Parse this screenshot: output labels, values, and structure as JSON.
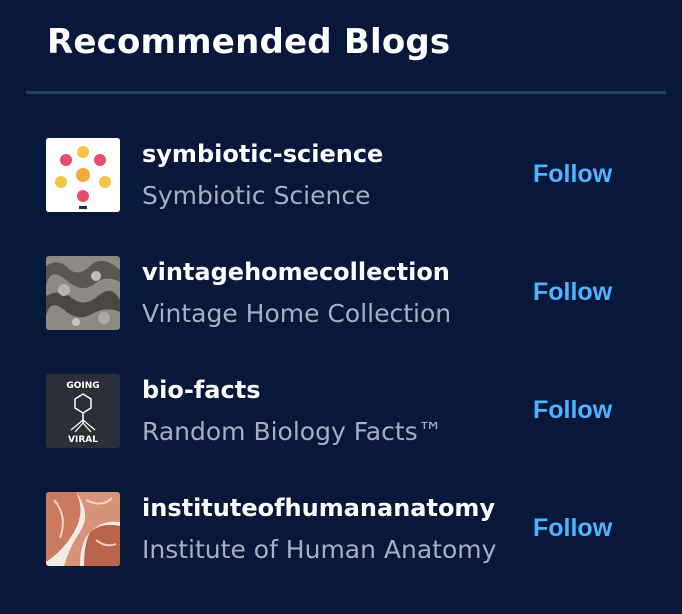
{
  "widget": {
    "title": "Recommended Blogs"
  },
  "blogs": [
    {
      "name": "symbiotic-science",
      "title": "Symbiotic Science",
      "follow_label": "Follow",
      "avatar_icon": "science-icons-avatar"
    },
    {
      "name": "vintagehomecollection",
      "title": "Vintage Home Collection",
      "follow_label": "Follow",
      "avatar_icon": "vintage-pattern-avatar"
    },
    {
      "name": "bio-facts",
      "title": "Random Biology Facts™",
      "follow_label": "Follow",
      "avatar_icon": "virus-avatar",
      "avatar_text_top": "GOING",
      "avatar_text_bottom": "VIRAL"
    },
    {
      "name": "instituteofhumananatomy",
      "title": "Institute of Human Anatomy",
      "follow_label": "Follow",
      "avatar_icon": "anatomy-muscle-avatar"
    }
  ],
  "colors": {
    "background": "#07183a",
    "divider": "#27405d",
    "accent": "#4fb3ff",
    "subtitle": "#a5afc0"
  }
}
